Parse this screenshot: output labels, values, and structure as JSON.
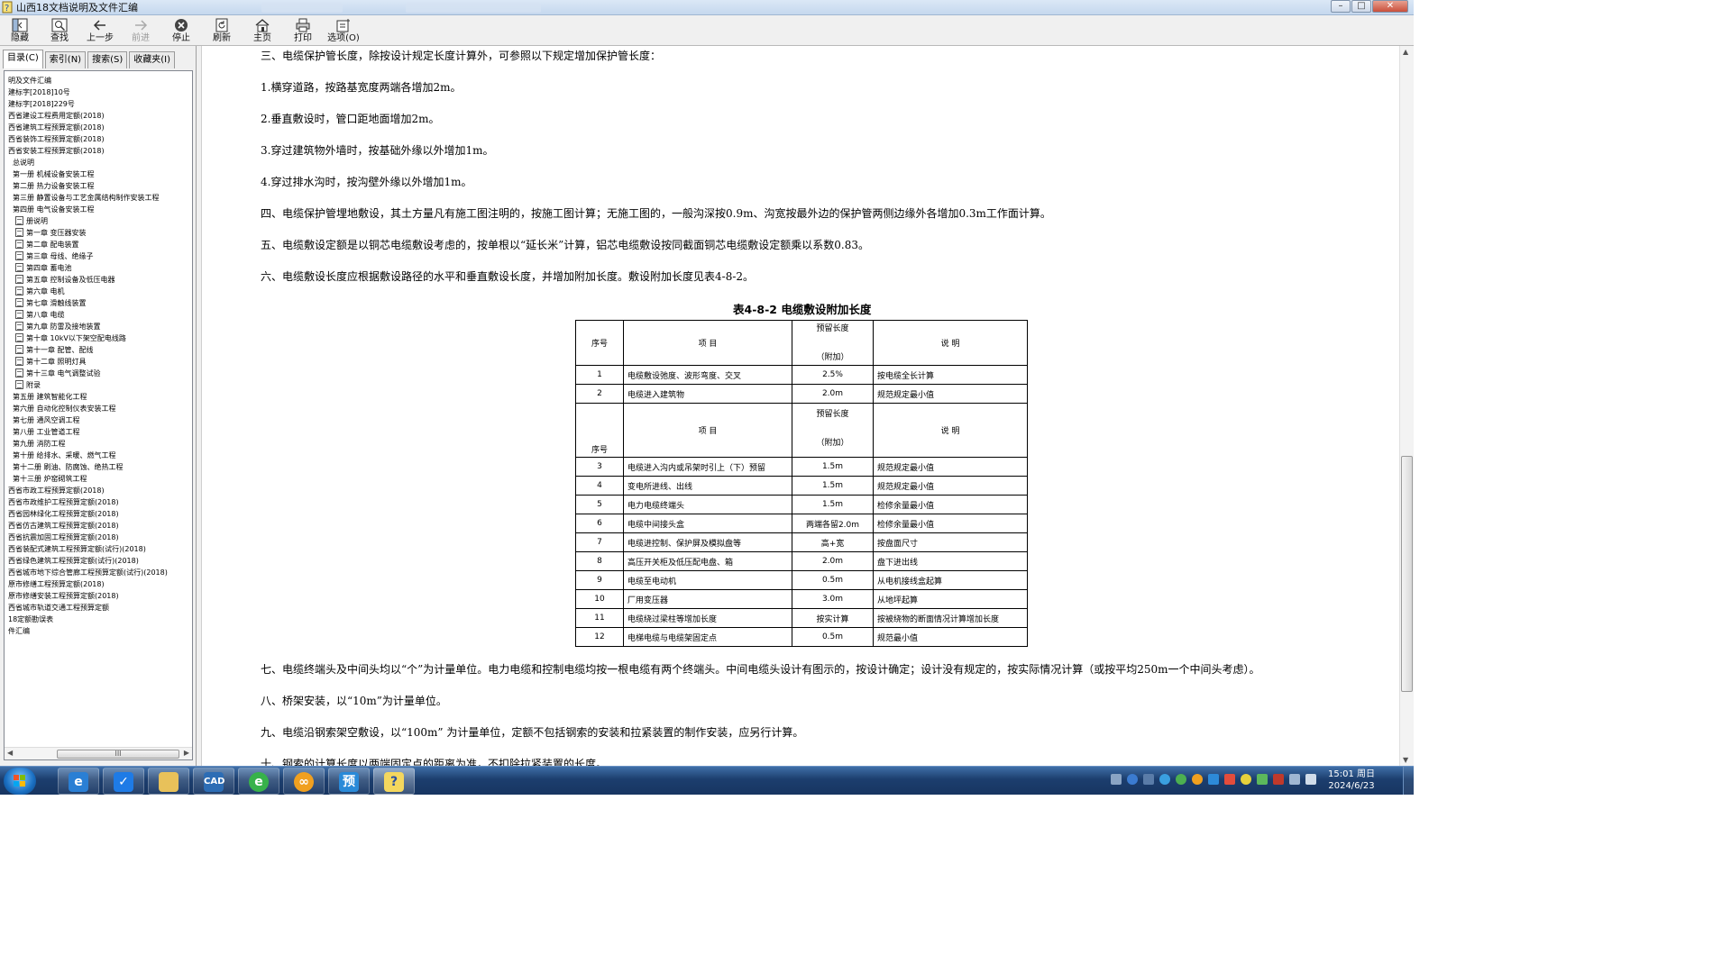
{
  "window": {
    "title": "山西18文档说明及文件汇编"
  },
  "toolbar": {
    "hide": "隐藏",
    "find": "查找",
    "back": "上一步",
    "forward": "前进",
    "stop": "停止",
    "refresh": "刷新",
    "home": "主页",
    "print": "打印",
    "options": "选项(O)"
  },
  "tabs": [
    "目录(C)",
    "索引(N)",
    "搜索(S)",
    "收藏夹(I)"
  ],
  "tree": [
    {
      "label": "明及文件汇编",
      "indent": 0,
      "page": false
    },
    {
      "label": "建标字[2018]10号",
      "indent": 0,
      "page": false
    },
    {
      "label": "建标字[2018]229号",
      "indent": 0,
      "page": false
    },
    {
      "label": "西省建设工程费用定额(2018)",
      "indent": 0,
      "page": false
    },
    {
      "label": "西省建筑工程预算定额(2018)",
      "indent": 0,
      "page": false
    },
    {
      "label": "西省装饰工程预算定额(2018)",
      "indent": 0,
      "page": false
    },
    {
      "label": "西省安装工程预算定额(2018)",
      "indent": 0,
      "page": false
    },
    {
      "label": "总说明",
      "indent": 1,
      "page": false
    },
    {
      "label": "第一册 机械设备安装工程",
      "indent": 1,
      "page": false
    },
    {
      "label": "第二册 热力设备安装工程",
      "indent": 1,
      "page": false
    },
    {
      "label": "第三册 静置设备与工艺金属结构制作安装工程",
      "indent": 1,
      "page": false
    },
    {
      "label": "第四册 电气设备安装工程",
      "indent": 1,
      "page": false
    },
    {
      "label": "册说明",
      "indent": 2,
      "page": true
    },
    {
      "label": "第一章 变压器安装",
      "indent": 2,
      "page": true
    },
    {
      "label": "第二章 配电装置",
      "indent": 2,
      "page": true
    },
    {
      "label": "第三章 母线、绝缘子",
      "indent": 2,
      "page": true
    },
    {
      "label": "第四章 蓄电池",
      "indent": 2,
      "page": true
    },
    {
      "label": "第五章 控制设备及低压电器",
      "indent": 2,
      "page": true
    },
    {
      "label": "第六章 电机",
      "indent": 2,
      "page": true
    },
    {
      "label": "第七章 滑触线装置",
      "indent": 2,
      "page": true
    },
    {
      "label": "第八章 电缆",
      "indent": 2,
      "page": true
    },
    {
      "label": "第九章 防雷及接地装置",
      "indent": 2,
      "page": true
    },
    {
      "label": "第十章 10kV以下架空配电线路",
      "indent": 2,
      "page": true
    },
    {
      "label": "第十一章 配管、配线",
      "indent": 2,
      "page": true
    },
    {
      "label": "第十二章 照明灯具",
      "indent": 2,
      "page": true
    },
    {
      "label": "第十三章 电气调整试验",
      "indent": 2,
      "page": true
    },
    {
      "label": "附录",
      "indent": 2,
      "page": true
    },
    {
      "label": "第五册 建筑智能化工程",
      "indent": 1,
      "page": false
    },
    {
      "label": "第六册 自动化控制仪表安装工程",
      "indent": 1,
      "page": false
    },
    {
      "label": "第七册 通风空调工程",
      "indent": 1,
      "page": false
    },
    {
      "label": "第八册 工业管道工程",
      "indent": 1,
      "page": false
    },
    {
      "label": "第九册 消防工程",
      "indent": 1,
      "page": false
    },
    {
      "label": "第十册 给排水、采暖、燃气工程",
      "indent": 1,
      "page": false
    },
    {
      "label": "第十二册 刷油、防腐蚀、绝热工程",
      "indent": 1,
      "page": false
    },
    {
      "label": "第十三册 炉窑砌筑工程",
      "indent": 1,
      "page": false
    },
    {
      "label": "西省市政工程预算定额(2018)",
      "indent": 0,
      "page": false
    },
    {
      "label": "西省市政维护工程预算定额(2018)",
      "indent": 0,
      "page": false
    },
    {
      "label": "西省园林绿化工程预算定额(2018)",
      "indent": 0,
      "page": false
    },
    {
      "label": "西省仿古建筑工程预算定额(2018)",
      "indent": 0,
      "page": false
    },
    {
      "label": "西省抗震加固工程预算定额(2018)",
      "indent": 0,
      "page": false
    },
    {
      "label": "西省装配式建筑工程预算定额(试行)(2018)",
      "indent": 0,
      "page": false
    },
    {
      "label": "西省绿色建筑工程预算定额(试行)(2018)",
      "indent": 0,
      "page": false
    },
    {
      "label": "西省城市地下综合管廊工程预算定额(试行)(2018)",
      "indent": 0,
      "page": false
    },
    {
      "label": "原市修缮工程预算定额(2018)",
      "indent": 0,
      "page": false
    },
    {
      "label": "原市修缮安装工程预算定额(2018)",
      "indent": 0,
      "page": false
    },
    {
      "label": "西省城市轨道交通工程预算定额",
      "indent": 0,
      "page": false
    },
    {
      "label": "18定额勘误表",
      "indent": 0,
      "page": false
    },
    {
      "label": "件汇编",
      "indent": 0,
      "page": false
    }
  ],
  "hscroll_grip": "III",
  "content": {
    "paragraphs": [
      "三、电缆保护管长度，除按设计规定长度计算外，可参照以下规定增加保护管长度：",
      "1.横穿道路，按路基宽度两端各增加2m。",
      "2.垂直敷设时，管口距地面增加2m。",
      "3.穿过建筑物外墙时，按基础外缘以外增加1m。",
      "4.穿过排水沟时，按沟壁外缘以外增加1m。",
      "四、电缆保护管埋地敷设，其土方量凡有施工图注明的，按施工图计算；无施工图的，一般沟深按0.9m、沟宽按最外边的保护管两侧边缘外各增加0.3m工作面计算。",
      "五、电缆敷设定额是以铜芯电缆敷设考虑的，按单根以“延长米”计算，铝芯电缆敷设按同截面铜芯电缆敷设定额乘以系数0.83。",
      "六、电缆敷设长度应根据敷设路径的水平和垂直敷设长度，并增加附加长度。敷设附加长度见表4-8-2。"
    ],
    "table_title": "表4-8-2  电缆敷设附加长度",
    "header": {
      "no": "序号",
      "item": "项  目",
      "len1": "预留长度",
      "len2": "（附加）",
      "note": "说  明"
    },
    "header2": {
      "no": "序号",
      "item": "项      目",
      "len1": "预留长度",
      "len2": "（附加）",
      "note": "说  明"
    },
    "rows_a": [
      {
        "no": "1",
        "item": "电缆敷设弛度、波形弯度、交叉",
        "len": "2.5%",
        "note": "按电缆全长计算"
      },
      {
        "no": "2",
        "item": "电缆进入建筑物",
        "len": "2.0m",
        "note": "规范规定最小值"
      }
    ],
    "rows_b": [
      {
        "no": "3",
        "item": "电缆进入沟内或吊架时引上（下）预留",
        "len": "1.5m",
        "note": "规范规定最小值"
      },
      {
        "no": "4",
        "item": "变电所进线、出线",
        "len": "1.5m",
        "note": "规范规定最小值"
      },
      {
        "no": "5",
        "item": "电力电缆终端头",
        "len": "1.5m",
        "note": "检修余量最小值"
      },
      {
        "no": "6",
        "item": "电缆中间接头盒",
        "len": "两端各留2.0m",
        "note": "检修余量最小值"
      },
      {
        "no": "7",
        "item": "电缆进控制、保护屏及模拟盘等",
        "len": "高+宽",
        "note": "按盘面尺寸"
      },
      {
        "no": "8",
        "item": "高压开关柜及低压配电盘、箱",
        "len": "2.0m",
        "note": "盘下进出线"
      },
      {
        "no": "9",
        "item": "电缆至电动机",
        "len": "0.5m",
        "note": "从电机接线盒起算"
      },
      {
        "no": "10",
        "item": "厂用变压器",
        "len": "3.0m",
        "note": " 从地坪起算"
      },
      {
        "no": "11",
        "item": "电缆绕过梁柱等增加长度",
        "len": "按实计算",
        "note": "按被绕物的断面情况计算增加长度"
      },
      {
        "no": "12",
        "item": "电梯电缆与电缆架固定点",
        "len": "0.5m",
        "note": " 规范最小值"
      }
    ],
    "paragraphs_after": [
      "七、电缆终端头及中间头均以“个”为计量单位。电力电缆和控制电缆均按一根电缆有两个终端头。中间电缆头设计有图示的，按设计确定；设计没有规定的，按实际情况计算（或按平均250m一个中间头考虑）。",
      "八、桥架安装，以“10m”为计量单位。",
      "九、电缆沿钢索架空敷设，以“100m” 为计量单位，定额不包括钢索的安装和拉紧装置的制作安装，应另行计算。",
      "十、钢索的计算长度以两端固定点的距离为准，不扣除拉紧装置的长度。"
    ]
  },
  "taskbar": {
    "buttons": [
      "ie-like-app",
      "feishu-like-app",
      "file-explorer",
      "cad-app",
      "browser-360",
      "cloud-app",
      "preview-app",
      "help-viewer"
    ],
    "cad_label": "CAD",
    "preview_label": "预",
    "help_label": "?",
    "clock_time": "15:01 周日",
    "clock_date": "2024/6/23"
  },
  "colors": {
    "accent": "#1c3e6e",
    "titlebar": "#c5d8ee",
    "close": "#c94f3b"
  }
}
